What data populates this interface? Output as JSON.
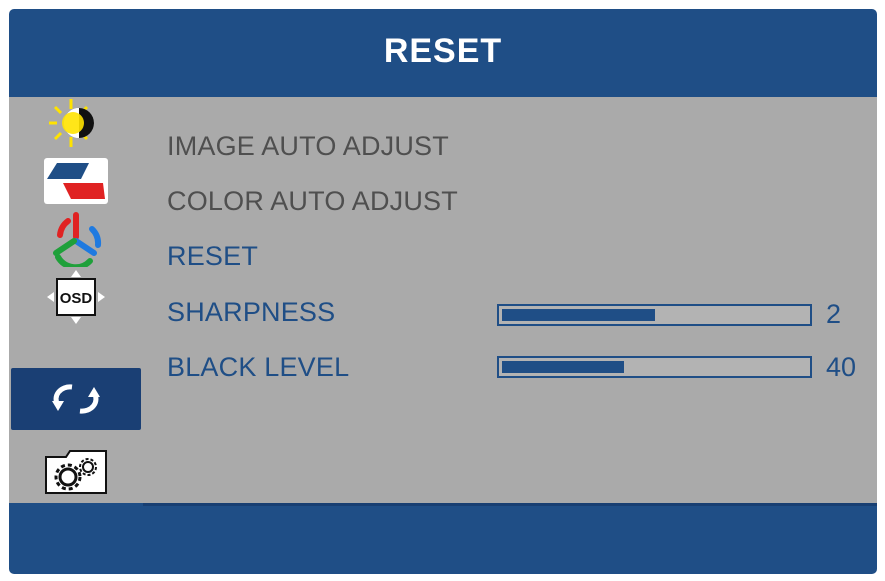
{
  "header": {
    "title": "RESET"
  },
  "sidebar": {
    "icons": [
      {
        "name": "brightness-contrast-icon"
      },
      {
        "name": "image-setup-icon"
      },
      {
        "name": "color-setup-icon"
      },
      {
        "name": "osd-setup-icon",
        "label": "OSD"
      },
      {
        "name": "reset-icon",
        "active": true
      },
      {
        "name": "extra-settings-icon"
      }
    ]
  },
  "menu": {
    "items": [
      {
        "label": "IMAGE AUTO ADJUST",
        "enabled": false
      },
      {
        "label": "COLOR AUTO ADJUST",
        "enabled": false
      },
      {
        "label": "RESET",
        "enabled": true
      },
      {
        "label": "SHARPNESS",
        "enabled": true,
        "value": "2",
        "level": 0.5
      },
      {
        "label": "BLACK LEVEL",
        "enabled": true,
        "value": "40",
        "level": 0.4
      }
    ]
  },
  "colors": {
    "frame": "#1f4e86",
    "panel": "#aaaaaa",
    "disabled_text": "#4f4f4f",
    "accent": "#1f4e86"
  }
}
